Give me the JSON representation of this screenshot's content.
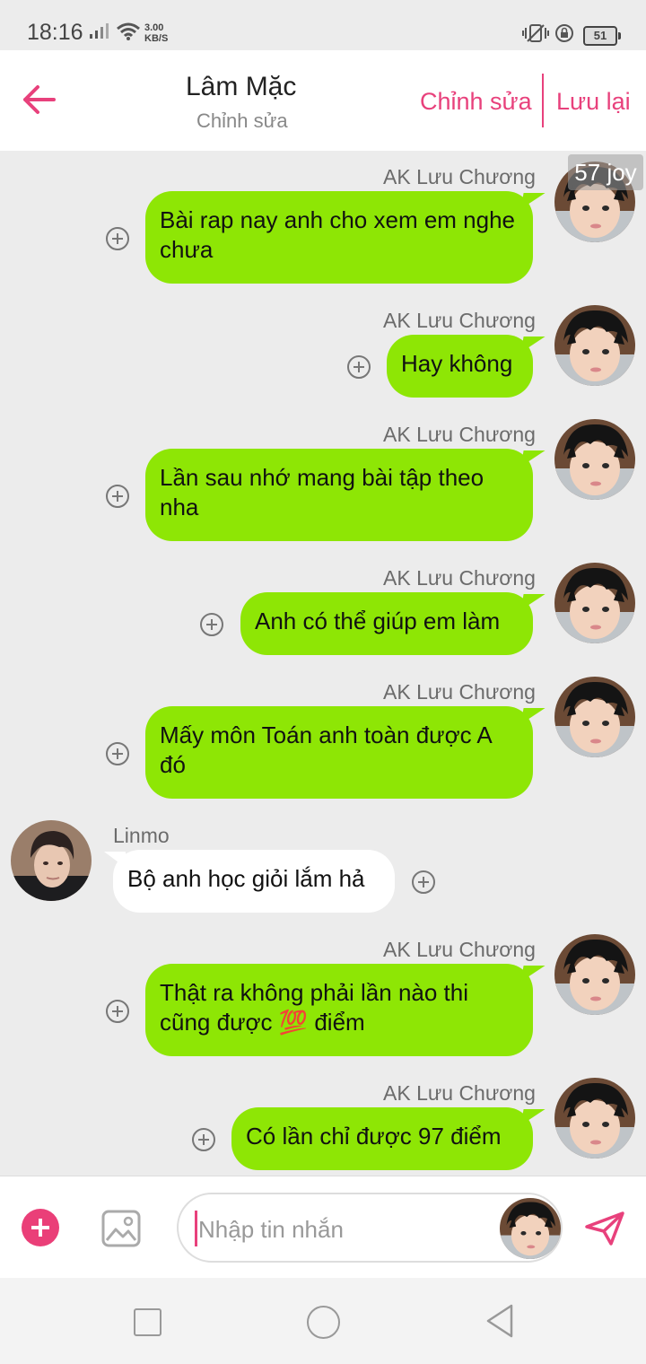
{
  "status": {
    "time": "18:16",
    "net_speed_value": "3.00",
    "net_speed_unit": "KB/S",
    "battery": "51"
  },
  "header": {
    "title": "Lâm Mặc",
    "subtitle": "Chỉnh sửa",
    "edit_label": "Chỉnh sửa",
    "save_label": "Lưu lại"
  },
  "overlay": {
    "joy": "57 joy"
  },
  "messages": [
    {
      "sender": "AK Lưu Chương",
      "text": "Bài rap nay anh cho xem em nghe chưa",
      "side": "right"
    },
    {
      "sender": "AK Lưu Chương",
      "text": "Hay không",
      "side": "right"
    },
    {
      "sender": "AK Lưu Chương",
      "text": "Lần sau nhớ mang bài tập theo nha",
      "side": "right"
    },
    {
      "sender": "AK Lưu Chương",
      "text": "Anh có thể giúp em làm",
      "side": "right"
    },
    {
      "sender": "AK Lưu Chương",
      "text": "Mấy môn Toán anh toàn được A đó",
      "side": "right"
    },
    {
      "sender": "Linmo",
      "text": "Bộ anh học giỏi lắm hả",
      "side": "left"
    },
    {
      "sender": "AK Lưu Chương",
      "text": "Thật ra không phải lần nào thi cũng được 💯 điểm",
      "side": "right"
    },
    {
      "sender": "AK Lưu Chương",
      "text": "Có lần chỉ được 97 điểm",
      "side": "right"
    }
  ],
  "input": {
    "placeholder": "Nhập tin nhắn"
  },
  "colors": {
    "accent": "#e8417c",
    "out_bubble": "#8ee605",
    "in_bubble": "#ffffff",
    "background": "#ececec"
  }
}
